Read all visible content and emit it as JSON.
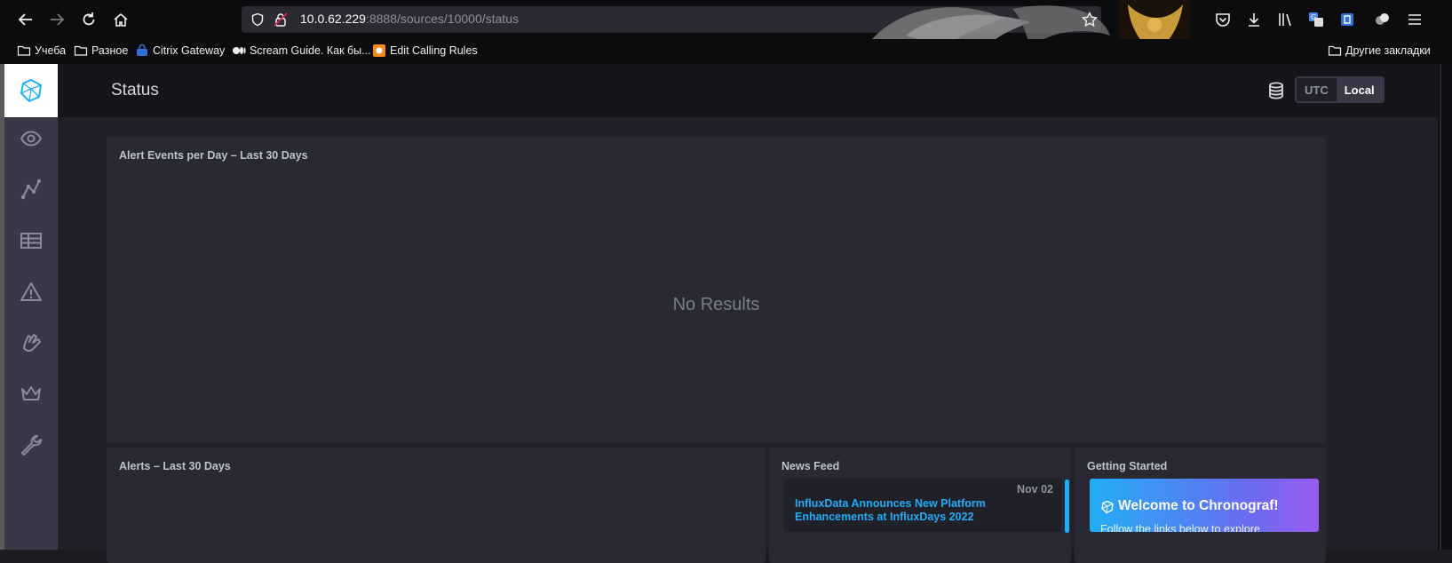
{
  "browser": {
    "url_host": "10.0.62.229",
    "url_rest": ":8888/sources/10000/status",
    "bookmarks": [
      {
        "label": "Учеба",
        "icon": "folder-icon"
      },
      {
        "label": "Разное",
        "icon": "folder-icon"
      },
      {
        "label": "Citrix Gateway",
        "icon": "citrix-icon"
      },
      {
        "label": "Scream Guide. Как бы...",
        "icon": "medium-icon"
      },
      {
        "label": "Edit Calling Rules",
        "icon": "app-icon"
      }
    ],
    "other_bookmarks": "Другие закладки"
  },
  "sidebar": {
    "items": [
      {
        "name": "host-list",
        "icon": "eye-icon"
      },
      {
        "name": "data-explorer",
        "icon": "graph-icon"
      },
      {
        "name": "dashboards",
        "icon": "table-icon"
      },
      {
        "name": "alerting",
        "icon": "alert-triangle-icon"
      },
      {
        "name": "log-viewer",
        "icon": "hand-icon"
      },
      {
        "name": "admin",
        "icon": "crown-icon"
      },
      {
        "name": "configuration",
        "icon": "wrench-icon"
      }
    ]
  },
  "header": {
    "title": "Status",
    "timezone": {
      "utc": "UTC",
      "local": "Local",
      "selected": "Local"
    }
  },
  "panels": {
    "alert_events": {
      "title": "Alert Events per Day – Last 30 Days",
      "empty_text": "No Results"
    },
    "alerts": {
      "title": "Alerts – Last 30 Days"
    },
    "news": {
      "title": "News Feed",
      "items": [
        {
          "date": "Nov 02",
          "headline": "InfluxData Announces New Platform Enhancements at InfluxDays 2022"
        }
      ]
    },
    "getting_started": {
      "title": "Getting Started",
      "welcome_title": "Welcome to Chronograf!",
      "welcome_sub": "Follow the links below to explore"
    }
  },
  "colors": {
    "accent": "#22adf6",
    "sidebar": "#383846",
    "panel": "#292933",
    "background": "#202028"
  }
}
